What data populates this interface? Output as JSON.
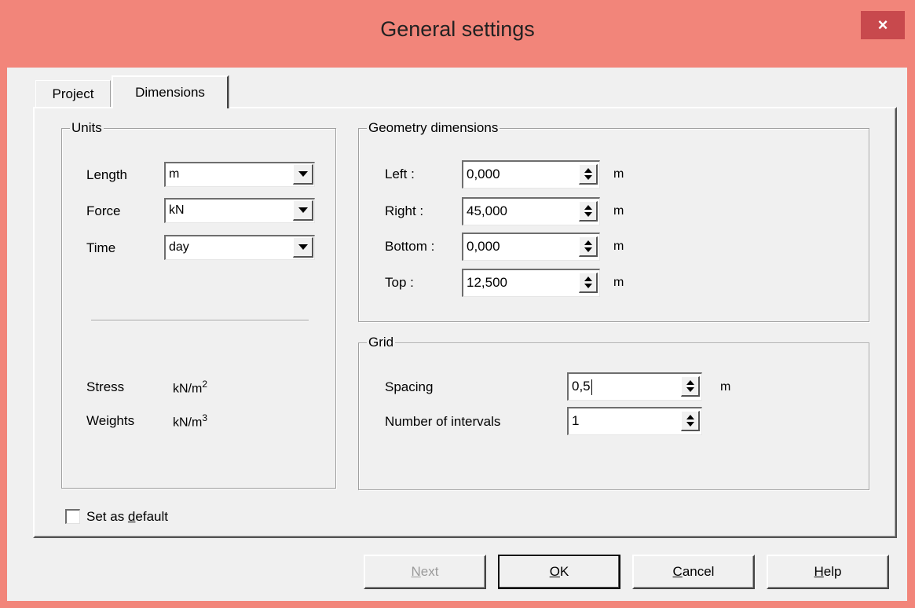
{
  "window": {
    "title": "General settings",
    "close_label": "×"
  },
  "tabs": [
    {
      "label": "Project",
      "active": false
    },
    {
      "label": "Dimensions",
      "active": true
    }
  ],
  "units": {
    "title": "Units",
    "length_label": "Length",
    "length_value": "m",
    "force_label": "Force",
    "force_value": "kN",
    "time_label": "Time",
    "time_value": "day",
    "stress_label": "Stress",
    "stress_unit": "kN/m",
    "stress_exp": "2",
    "weights_label": "Weights",
    "weights_unit": "kN/m",
    "weights_exp": "3"
  },
  "geometry": {
    "title": "Geometry dimensions",
    "left_label": "Left :",
    "left_value": "0,000",
    "right_label": "Right :",
    "right_value": "45,000",
    "bottom_label": "Bottom :",
    "bottom_value": "0,000",
    "top_label": "Top :",
    "top_value": "12,500",
    "unit": "m"
  },
  "grid": {
    "title": "Grid",
    "spacing_label": "Spacing",
    "spacing_value": "0,5",
    "spacing_unit": "m",
    "intervals_label": "Number of intervals",
    "intervals_value": "1"
  },
  "default_checkbox": {
    "pre": "Set as ",
    "accel": "d",
    "post": "efault",
    "checked": false
  },
  "buttons": {
    "next": {
      "accel": "N",
      "rest": "ext",
      "enabled": false
    },
    "ok": {
      "accel": "O",
      "rest": "K"
    },
    "cancel": {
      "accel": "C",
      "rest": "ancel"
    },
    "help": {
      "accel": "H",
      "rest": "elp"
    }
  },
  "colors": {
    "title_bar": "#f2857a",
    "close_button": "#c8494d",
    "dialog_bg": "#f0f0f0"
  }
}
